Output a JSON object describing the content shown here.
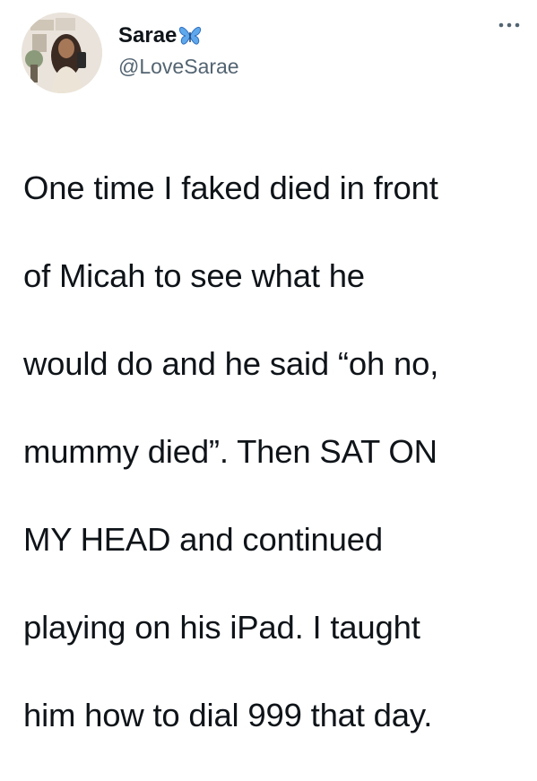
{
  "tweet": {
    "display_name": "Sarae",
    "handle": "@LoveSarae",
    "verified_emoji": "butterfly-icon",
    "body_lines": [
      "One time I faked died in front",
      "of Micah to see what he",
      "would do and he said “oh no,",
      "mummy died”. Then SAT ON",
      "MY HEAD and continued",
      "playing on his iPad. I taught",
      "him how to dial 999 that day."
    ],
    "more_icon": "more-horizontal-icon"
  },
  "colors": {
    "text_primary": "#0f1419",
    "text_secondary": "#536471",
    "butterfly_blue": "#3f8ee0"
  }
}
